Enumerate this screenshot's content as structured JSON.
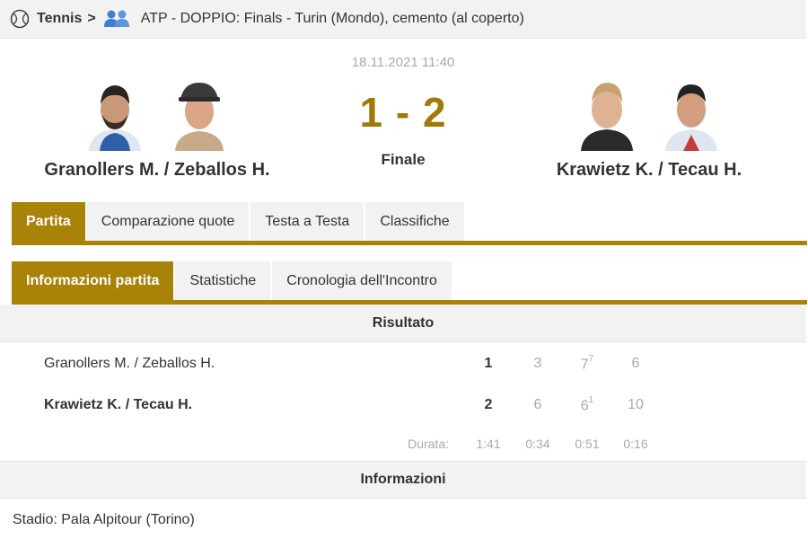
{
  "breadcrumb": {
    "sport": "Tennis",
    "separator": ">",
    "tournament": "ATP - DOPPIO: Finals - Turin (Mondo), cemento (al coperto)",
    "sport_icon": "tennis-ball-icon",
    "doubles_icon": "doubles-players-icon"
  },
  "match": {
    "date": "18.11.2021 11:40",
    "score_home": "1",
    "score_sep": "-",
    "score_away": "2",
    "status": "Finale"
  },
  "home": {
    "name": "Granollers M. / Zeballos H."
  },
  "away": {
    "name": "Krawietz K. / Tecau H."
  },
  "tabs_main": [
    "Partita",
    "Comparazione quote",
    "Testa a Testa",
    "Classifiche"
  ],
  "tabs_sub": [
    "Informazioni partita",
    "Statistiche",
    "Cronologia dell'Incontro"
  ],
  "result": {
    "title": "Risultato",
    "rows": [
      {
        "name": "Granollers M. / Zeballos H.",
        "total": "1",
        "sets": [
          "3",
          "7",
          "6"
        ],
        "tiebreak": [
          "",
          "7",
          ""
        ]
      },
      {
        "name": "Krawietz K. / Tecau H.",
        "total": "2",
        "sets": [
          "6",
          "6",
          "10"
        ],
        "tiebreak": [
          "",
          "1",
          ""
        ]
      }
    ],
    "duration_label": "Durata:",
    "durations": [
      "1:41",
      "0:34",
      "0:51",
      "0:16"
    ]
  },
  "info": {
    "title": "Informazioni",
    "venue": "Stadio: Pala Alpitour (Torino)"
  },
  "colors": {
    "accent": "#a98208",
    "score": "#a07a06",
    "bar_bg": "#f2f2f2"
  }
}
